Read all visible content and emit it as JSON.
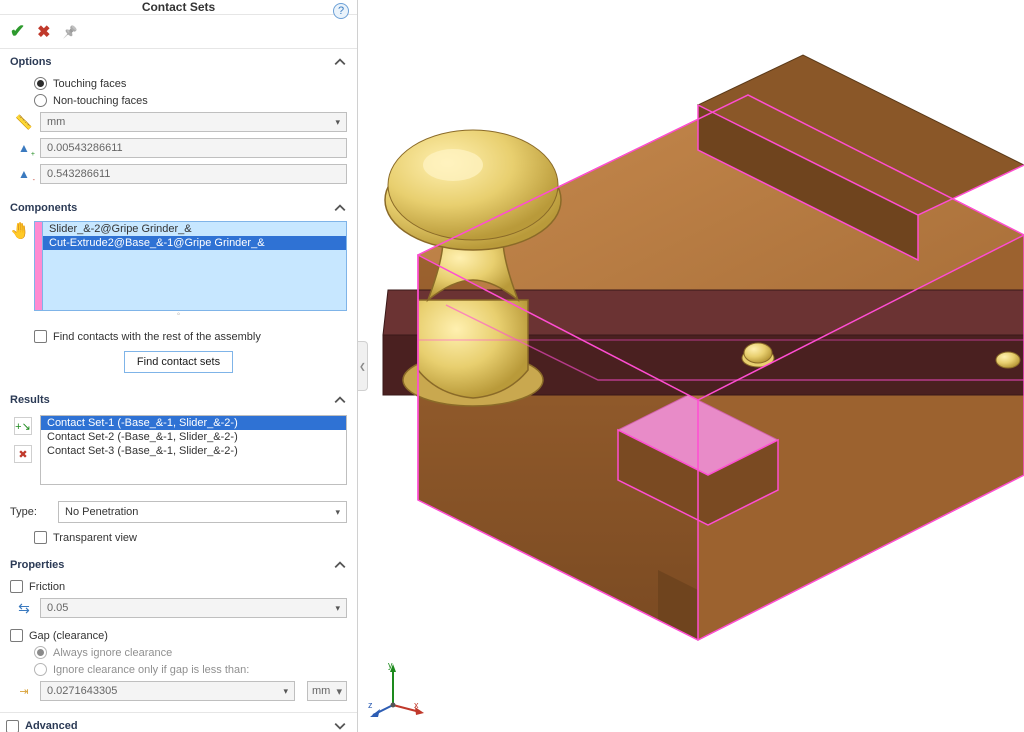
{
  "panelTitle": "Contact Sets",
  "sections": {
    "options": {
      "title": "Options",
      "radios": {
        "touching": "Touching faces",
        "nontouching": "Non-touching faces"
      },
      "unit": "mm",
      "val1": "0.00543286611",
      "val2": "0.543286611"
    },
    "components": {
      "title": "Components",
      "items": [
        "Slider_&-2@Gripe Grinder_&",
        "Cut-Extrude2@Base_&-1@Gripe Grinder_&"
      ],
      "findAssembly": "Find contacts with the rest of the assembly",
      "findBtn": "Find contact sets"
    },
    "results": {
      "title": "Results",
      "items": [
        "Contact Set-1 (-Base_&-1, Slider_&-2-)",
        "Contact Set-2 (-Base_&-1, Slider_&-2-)",
        "Contact Set-3 (-Base_&-1, Slider_&-2-)"
      ],
      "typeLabel": "Type:",
      "typeValue": "No Penetration",
      "transparent": "Transparent view"
    },
    "properties": {
      "title": "Properties",
      "friction": "Friction",
      "frictionVal": "0.05",
      "gap": "Gap (clearance)",
      "gapAlways": "Always ignore clearance",
      "gapIf": "Ignore clearance only if gap is less than:",
      "gapVal": "0.0271643305",
      "gapUnit": "mm"
    },
    "advanced": {
      "title": "Advanced"
    }
  },
  "triad": {
    "x": "x",
    "y": "y",
    "z": "z"
  }
}
